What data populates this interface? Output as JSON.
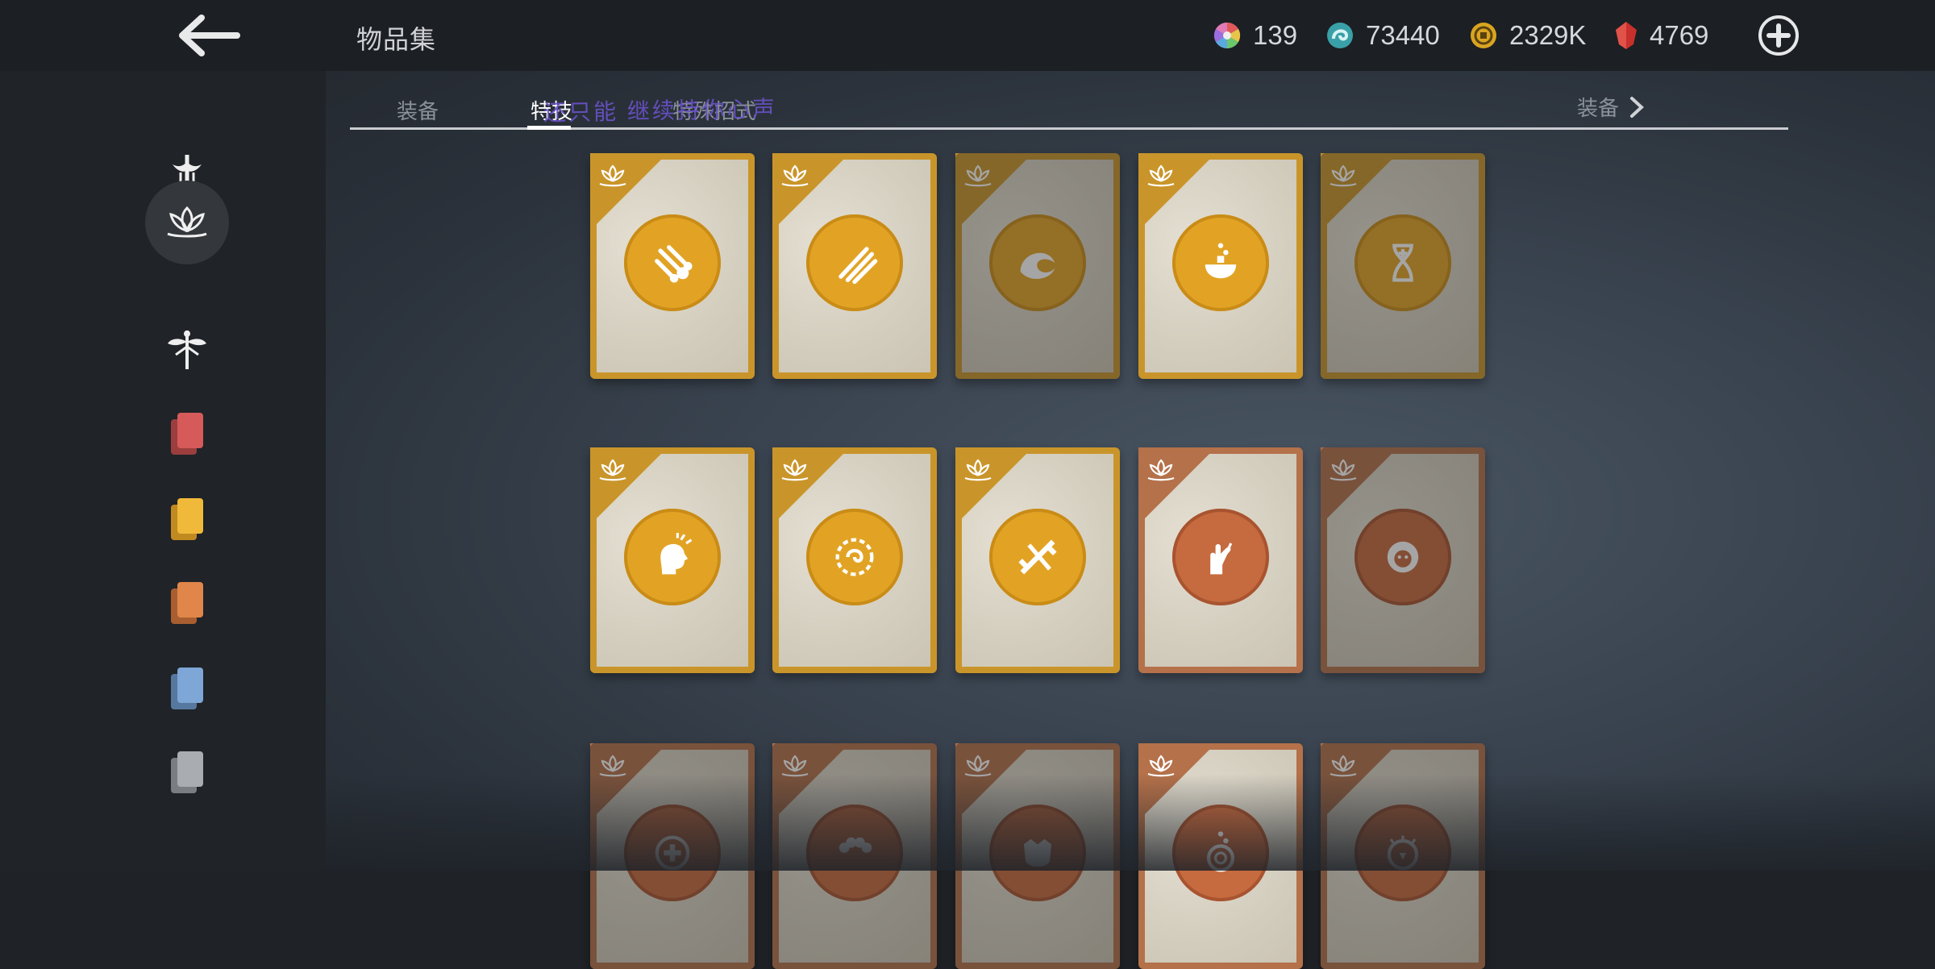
{
  "header": {
    "title": "物品集",
    "currencies": [
      {
        "icon": "rainbow-orb-icon",
        "value": "139"
      },
      {
        "icon": "swirl-orb-icon",
        "value": "73440"
      },
      {
        "icon": "gold-coin-icon",
        "value": "2329K"
      },
      {
        "icon": "red-gem-icon",
        "value": "4769"
      }
    ]
  },
  "sidebar": {
    "items": [
      {
        "icon": "sword-emblem-icon"
      },
      {
        "icon": "lotus-icon",
        "active": true
      },
      {
        "icon": "dragonfly-icon"
      },
      {
        "icon": "red-cards-icon",
        "color": "#d65a5a"
      },
      {
        "icon": "yellow-cards-icon",
        "color": "#f1b93a"
      },
      {
        "icon": "orange-cards-icon",
        "color": "#e0864a"
      },
      {
        "icon": "blue-cards-icon",
        "color": "#7ea6d6"
      },
      {
        "icon": "gray-cards-icon",
        "color": "#a9acb1"
      }
    ]
  },
  "tabs": {
    "items": [
      "装备",
      "特技",
      "特殊招式"
    ],
    "active": "特技",
    "next_label": "装备",
    "overlay_text": "还只能 继续持你心声"
  },
  "cards": [
    {
      "rarity": "gold",
      "icon": "meteor-icon",
      "locked": false
    },
    {
      "rarity": "gold",
      "icon": "claw-slash-icon",
      "locked": false
    },
    {
      "rarity": "gold",
      "icon": "wave-icon",
      "locked": true
    },
    {
      "rarity": "gold",
      "icon": "potion-bowl-icon",
      "locked": false
    },
    {
      "rarity": "gold",
      "icon": "hourglass-plus-icon",
      "locked": true
    },
    {
      "rarity": "gold",
      "icon": "head-burst-icon",
      "locked": false
    },
    {
      "rarity": "gold",
      "icon": "chain-vortex-icon",
      "locked": false
    },
    {
      "rarity": "gold",
      "icon": "crossed-blades-icon",
      "locked": false
    },
    {
      "rarity": "copper",
      "icon": "hand-sword-icon",
      "locked": false
    },
    {
      "rarity": "copper",
      "icon": "lion-head-icon",
      "locked": true
    },
    {
      "rarity": "copper",
      "icon": "heal-plus-icon",
      "locked": true
    },
    {
      "rarity": "copper",
      "icon": "worm-icon",
      "locked": true
    },
    {
      "rarity": "copper",
      "icon": "beast-face-icon",
      "locked": true
    },
    {
      "rarity": "copper",
      "icon": "spiral-potion-icon",
      "locked": false
    },
    {
      "rarity": "copper",
      "icon": "spiked-crest-icon",
      "locked": true
    }
  ]
}
